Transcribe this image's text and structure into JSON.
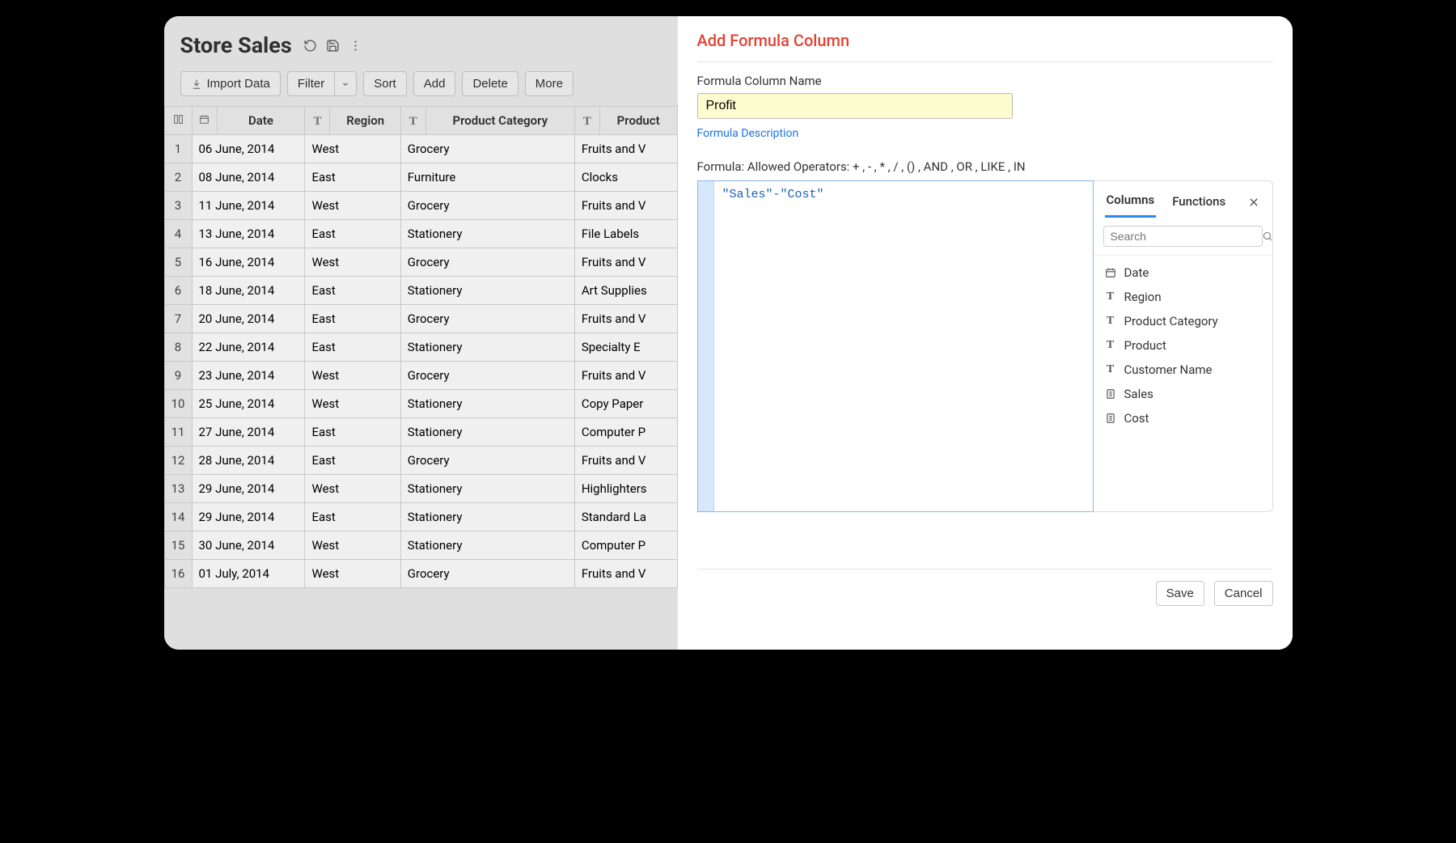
{
  "header": {
    "title": "Store Sales"
  },
  "toolbar": {
    "import": "Import Data",
    "filter": "Filter",
    "sort": "Sort",
    "add": "Add",
    "delete": "Delete",
    "more": "More"
  },
  "table": {
    "columns": [
      "Date",
      "Region",
      "Product Category",
      "Product"
    ],
    "rows": [
      {
        "i": "1",
        "date": "06 June, 2014",
        "region": "West",
        "cat": "Grocery",
        "prod": "Fruits and V"
      },
      {
        "i": "2",
        "date": "08 June, 2014",
        "region": "East",
        "cat": "Furniture",
        "prod": "Clocks"
      },
      {
        "i": "3",
        "date": "11 June, 2014",
        "region": "West",
        "cat": "Grocery",
        "prod": "Fruits and V"
      },
      {
        "i": "4",
        "date": "13 June, 2014",
        "region": "East",
        "cat": "Stationery",
        "prod": "File Labels"
      },
      {
        "i": "5",
        "date": "16 June, 2014",
        "region": "West",
        "cat": "Grocery",
        "prod": "Fruits and V"
      },
      {
        "i": "6",
        "date": "18 June, 2014",
        "region": "East",
        "cat": "Stationery",
        "prod": "Art Supplies"
      },
      {
        "i": "7",
        "date": "20 June, 2014",
        "region": "East",
        "cat": "Grocery",
        "prod": "Fruits and V"
      },
      {
        "i": "8",
        "date": "22 June, 2014",
        "region": "East",
        "cat": "Stationery",
        "prod": "Specialty E"
      },
      {
        "i": "9",
        "date": "23 June, 2014",
        "region": "West",
        "cat": "Grocery",
        "prod": "Fruits and V"
      },
      {
        "i": "10",
        "date": "25 June, 2014",
        "region": "West",
        "cat": "Stationery",
        "prod": "Copy Paper"
      },
      {
        "i": "11",
        "date": "27 June, 2014",
        "region": "East",
        "cat": "Stationery",
        "prod": "Computer P"
      },
      {
        "i": "12",
        "date": "28 June, 2014",
        "region": "East",
        "cat": "Grocery",
        "prod": "Fruits and V"
      },
      {
        "i": "13",
        "date": "29 June, 2014",
        "region": "West",
        "cat": "Stationery",
        "prod": "Highlighters"
      },
      {
        "i": "14",
        "date": "29 June, 2014",
        "region": "East",
        "cat": "Stationery",
        "prod": "Standard La"
      },
      {
        "i": "15",
        "date": "30 June, 2014",
        "region": "West",
        "cat": "Stationery",
        "prod": "Computer P"
      },
      {
        "i": "16",
        "date": "01 July, 2014",
        "region": "West",
        "cat": "Grocery",
        "prod": "Fruits and V"
      }
    ]
  },
  "panel": {
    "title": "Add Formula Column",
    "name_label": "Formula Column Name",
    "name_value": "Profit",
    "desc_link": "Formula Description",
    "allowed_label": "Formula: Allowed Operators: + , - , * , / , () , AND , OR , LIKE , IN",
    "formula": "\"Sales\"-\"Cost\"",
    "tabs": {
      "columns": "Columns",
      "functions": "Functions"
    },
    "search_placeholder": "Search",
    "available_columns": [
      {
        "type": "date",
        "label": "Date"
      },
      {
        "type": "text",
        "label": "Region"
      },
      {
        "type": "text",
        "label": "Product Category"
      },
      {
        "type": "text",
        "label": "Product"
      },
      {
        "type": "text",
        "label": "Customer Name"
      },
      {
        "type": "number",
        "label": "Sales"
      },
      {
        "type": "number",
        "label": "Cost"
      }
    ],
    "save": "Save",
    "cancel": "Cancel"
  }
}
